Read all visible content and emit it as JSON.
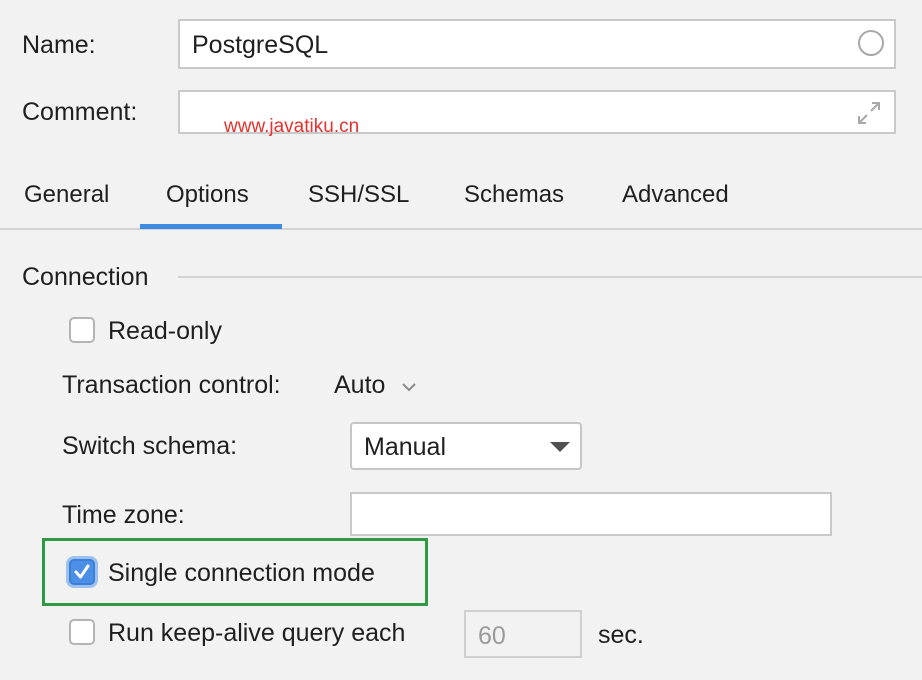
{
  "form": {
    "name_label": "Name:",
    "name_value": "PostgreSQL",
    "comment_label": "Comment:",
    "comment_value": "",
    "watermark": "www.javatiku.cn"
  },
  "tabs": [
    {
      "label": "General",
      "selected": false
    },
    {
      "label": "Options",
      "selected": true
    },
    {
      "label": "SSH/SSL",
      "selected": false
    },
    {
      "label": "Schemas",
      "selected": false
    },
    {
      "label": "Advanced",
      "selected": false
    }
  ],
  "connection": {
    "section_title": "Connection",
    "read_only": {
      "label": "Read-only",
      "checked": false
    },
    "transaction_control": {
      "label": "Transaction control:",
      "value": "Auto"
    },
    "switch_schema": {
      "label": "Switch schema:",
      "value": "Manual"
    },
    "time_zone": {
      "label": "Time zone:",
      "value": ""
    },
    "single_connection_mode": {
      "label": "Single connection mode",
      "checked": true
    },
    "keep_alive": {
      "label": "Run keep-alive query each",
      "value": "60",
      "unit": "sec.",
      "checked": false
    }
  },
  "colors": {
    "accent": "#3d8ce4",
    "highlight_border": "#2f9a43",
    "watermark": "#e8302c",
    "background": "#f2f2f2"
  },
  "icons": {
    "name_field_icon": "circle-icon",
    "comment_expand_icon": "expand-icon",
    "transaction_chevron": "chevron-down-icon",
    "select_arrow": "triangle-down-icon",
    "checkmark": "checkmark-icon"
  }
}
